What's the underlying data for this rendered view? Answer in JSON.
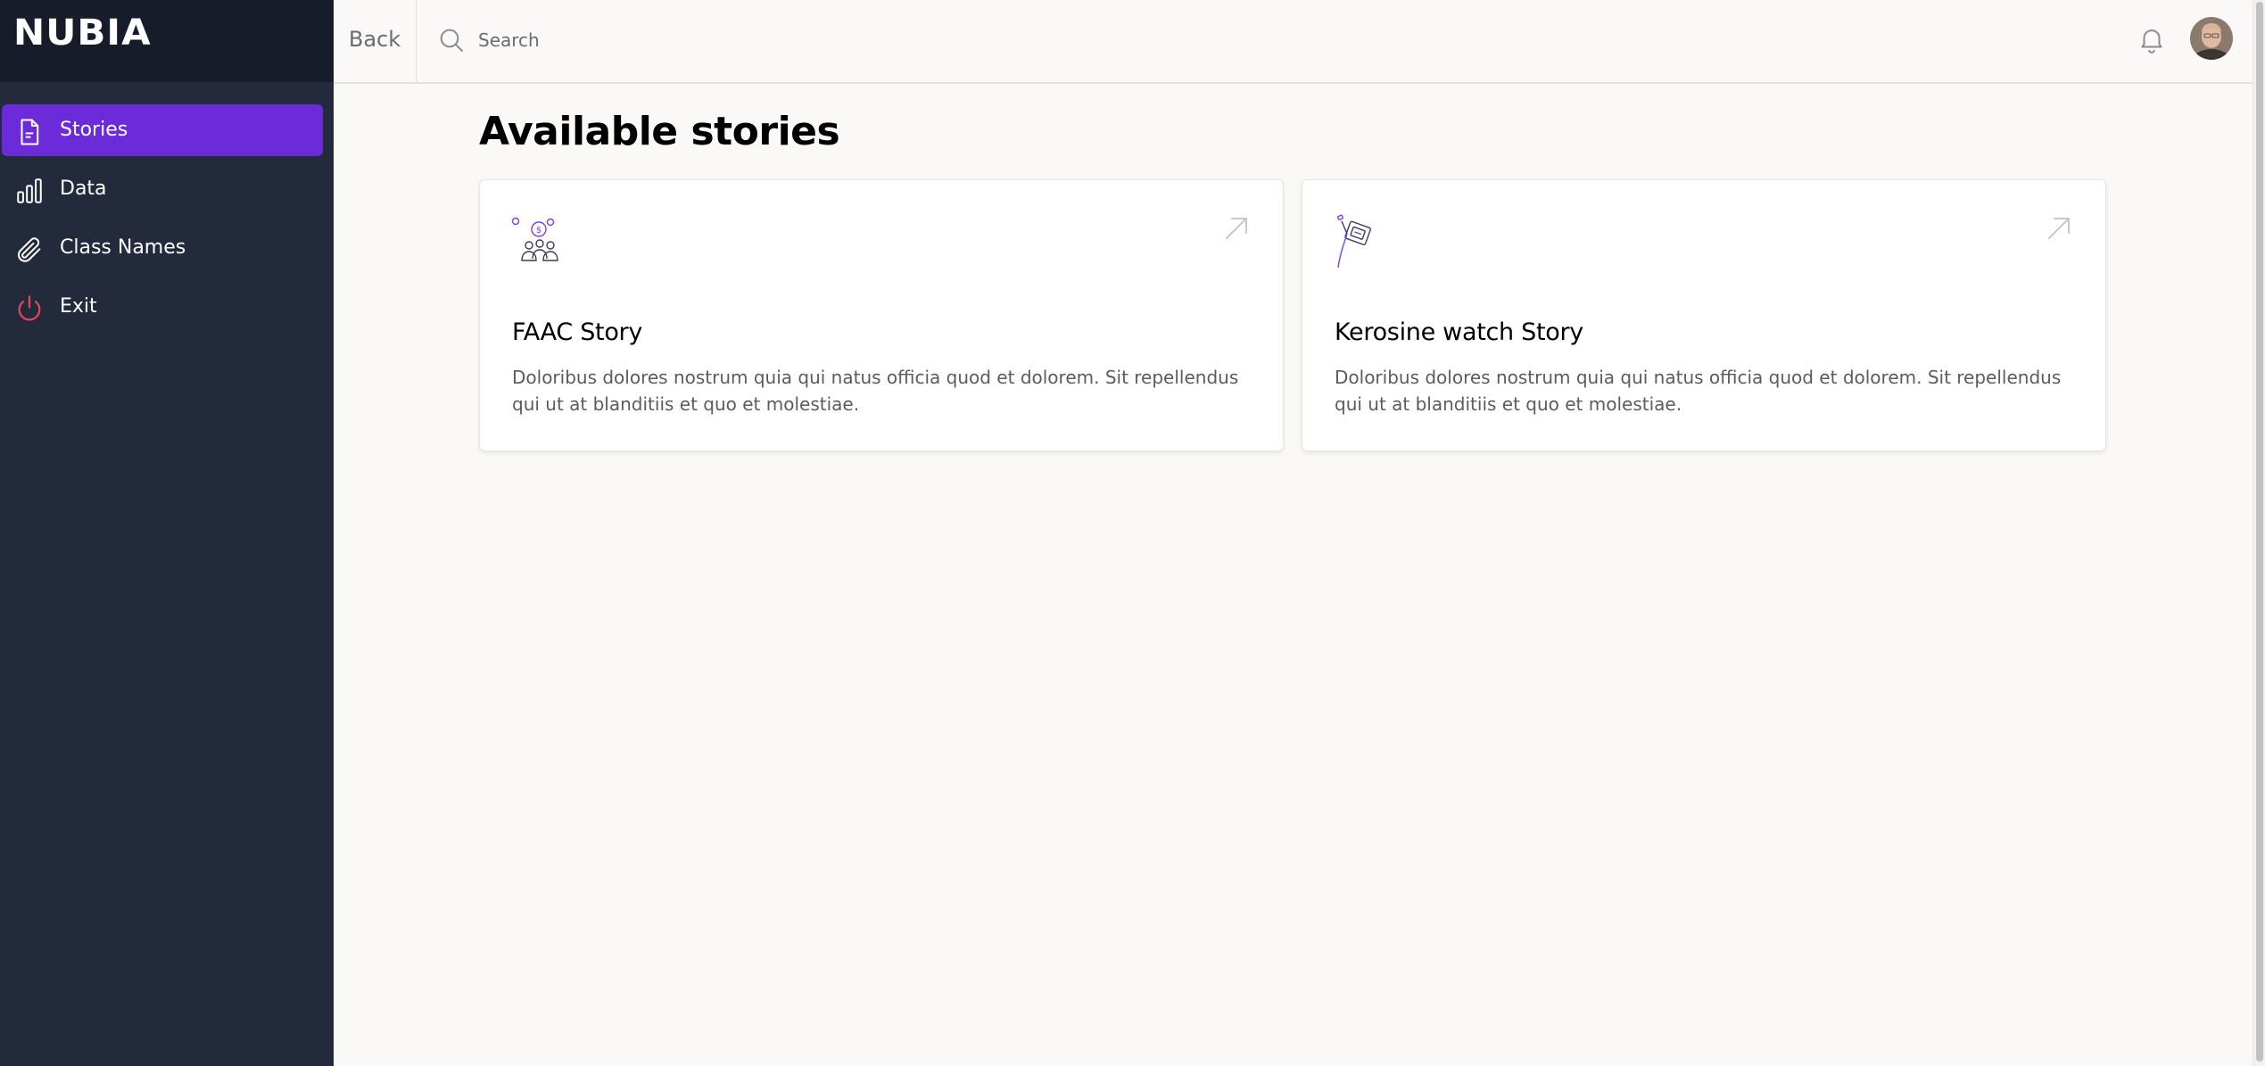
{
  "app": {
    "logo_text": "NUBIA"
  },
  "sidebar": {
    "items": [
      {
        "label": "Stories",
        "icon": "document-icon",
        "active": true
      },
      {
        "label": "Data",
        "icon": "bar-chart-icon",
        "active": false
      },
      {
        "label": "Class Names",
        "icon": "paperclip-icon",
        "active": false
      },
      {
        "label": "Exit",
        "icon": "power-icon",
        "active": false
      }
    ]
  },
  "topbar": {
    "back_label": "Back",
    "search_placeholder": "Search",
    "icons": [
      "search-icon",
      "bell-icon",
      "user-avatar"
    ]
  },
  "main": {
    "title": "Available stories",
    "cards": [
      {
        "title": "FAAC Story",
        "description": "Doloribus dolores nostrum quia qui natus officia quod et dolorem. Sit repellendus qui ut at blanditiis et quo et molestiae.",
        "icon": "people-money-illustration"
      },
      {
        "title": "Kerosine watch Story",
        "description": "Doloribus dolores nostrum quia qui natus officia quod et dolorem. Sit repellendus qui ut at blanditiis et quo et molestiae.",
        "icon": "fuel-pump-illustration"
      }
    ]
  },
  "colors": {
    "sidebar_bg": "#222a3c",
    "logo_bar_bg": "#161c2a",
    "accent": "#6c2bd9",
    "exit_icon": "#e0475c",
    "page_bg": "#faf9f7"
  }
}
